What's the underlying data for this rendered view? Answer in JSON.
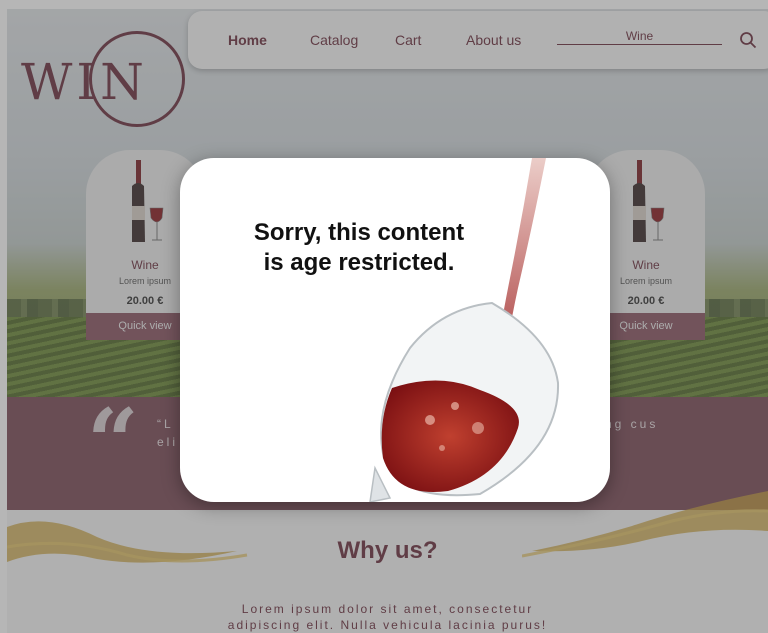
{
  "nav": {
    "logo_text": "WIN",
    "items": [
      "Home",
      "Catalog",
      "Cart",
      "About us"
    ],
    "search_value": "Wine",
    "search_icon": "search-icon"
  },
  "products": [
    {
      "name": "Wine",
      "desc": "Lorem ipsum",
      "price": "20.00 €",
      "button": "Quick view"
    },
    {
      "name": "Wine",
      "desc": "Lorem ipsum",
      "price": "20.00 €",
      "button": "Quick view"
    }
  ],
  "quote": {
    "mark": "“",
    "left_text": "“L eli",
    "right_text": "ng cus"
  },
  "why": {
    "title": "Why us?",
    "text_line1": "Lorem ipsum dolor sit amet, consectetur",
    "text_line2": "adipiscing elit. Nulla vehicula lacinia purus!"
  },
  "modal": {
    "message_line1": "Sorry, this content",
    "message_line2": "is age restricted."
  },
  "colors": {
    "brand": "#6b2f3e",
    "button": "#8a5563",
    "quote_band": "#7a4a57",
    "wine": "#9b1c1c"
  }
}
